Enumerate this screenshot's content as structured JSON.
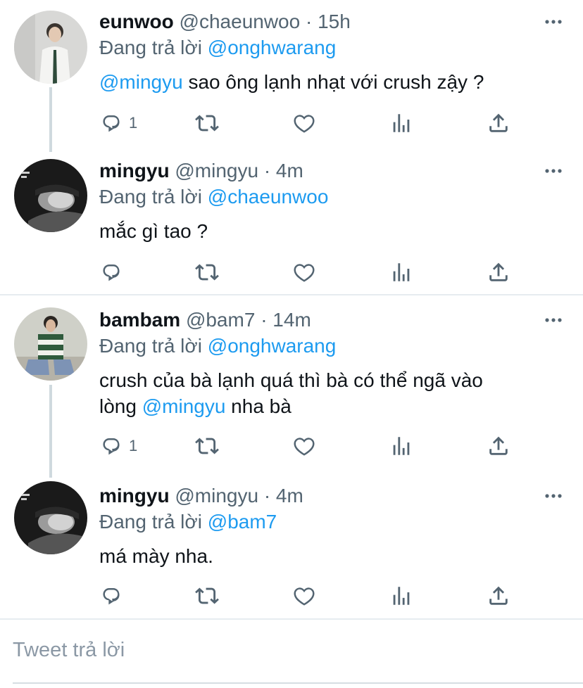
{
  "tweets": [
    {
      "name": "eunwoo",
      "handle": "@chaeunwoo",
      "dot": "·",
      "time": "15h",
      "replying_prefix": "Đang trả lời ",
      "replying_to": "@onghwarang",
      "body_mention": "@mingyu",
      "body_text": " sao ông lạnh nhạt với crush zậy ?",
      "reply_count": "1",
      "avatar": "man-in-white-shirt-photo"
    },
    {
      "name": "mingyu",
      "handle": "@mingyu",
      "dot": "·",
      "time": "4m",
      "replying_prefix": "Đang trả lời ",
      "replying_to": "@chaeunwoo",
      "body_text": "mắc gì tao ?",
      "reply_count": "",
      "avatar": "black-and-white-portrait"
    },
    {
      "name": "bambam",
      "handle": "@bam7",
      "dot": "·",
      "time": "14m",
      "replying_prefix": "Đang trả lời ",
      "replying_to": "@onghwarang",
      "body_text_1": "crush của bà lạnh quá thì bà có thể ngã vào",
      "body_text_2": "lòng ",
      "body_mention": "@mingyu",
      "body_text_3": " nha bà",
      "reply_count": "1",
      "avatar": "man-in-striped-sweater-photo"
    },
    {
      "name": "mingyu",
      "handle": "@mingyu",
      "dot": "·",
      "time": "4m",
      "replying_prefix": "Đang trả lời ",
      "replying_to": "@bam7",
      "body_text": "má mày nha.",
      "reply_count": "",
      "avatar": "black-and-white-portrait"
    }
  ],
  "icons": {
    "reply": "reply-icon",
    "retweet": "retweet-icon",
    "like": "like-icon",
    "analytics": "analytics-icon",
    "share": "share-icon",
    "more": "more-icon"
  },
  "colors": {
    "mention": "#1d9bf0",
    "secondary": "#536471",
    "thread_line": "#cfd9de"
  },
  "reply_box": {
    "placeholder": "Tweet trả lời"
  }
}
